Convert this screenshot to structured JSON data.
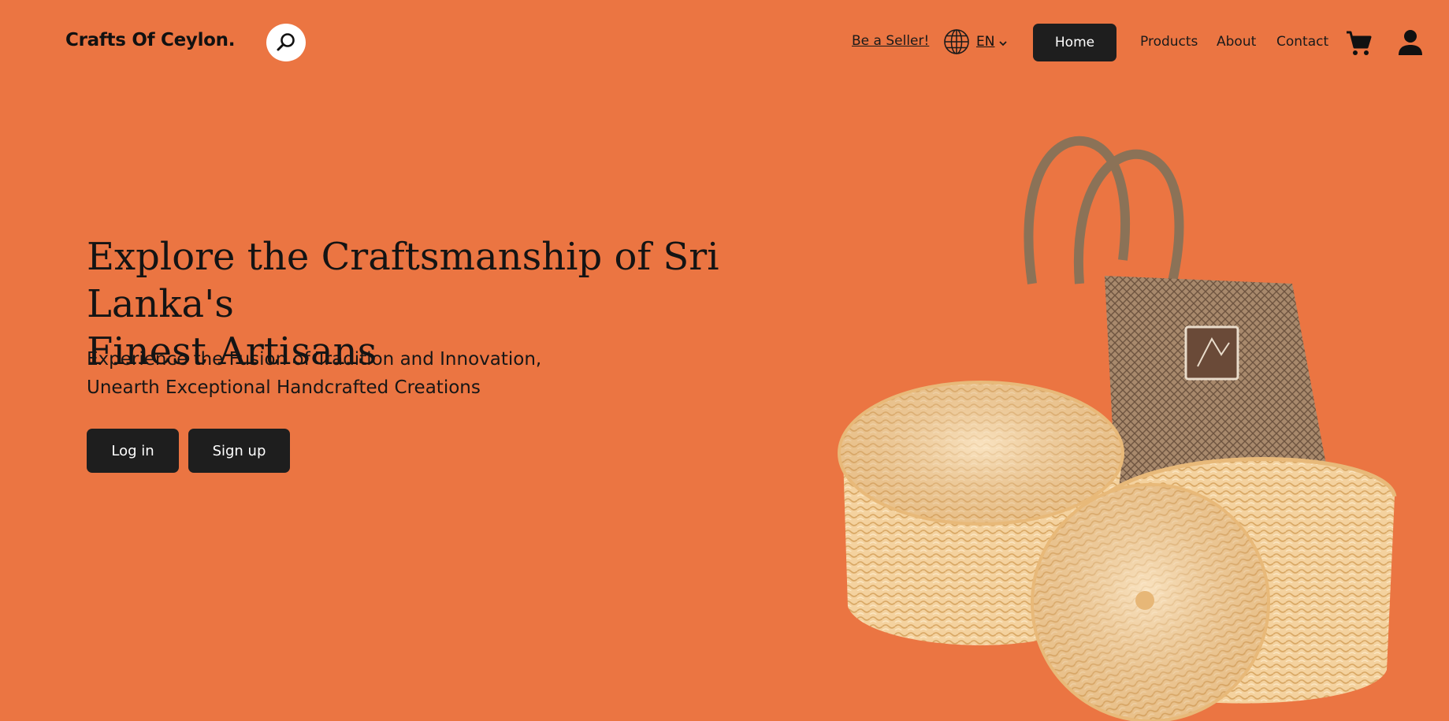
{
  "brand": {
    "logo_text": "Crafts Of Ceylon."
  },
  "nav": {
    "search_icon": "search-icon",
    "seller_link": "Be a Seller!",
    "language": {
      "icon": "globe-icon",
      "label": "EN"
    },
    "links": [
      "Home",
      "Products",
      "About",
      "Contact"
    ],
    "active_link": "Home",
    "cart_icon": "cart-icon",
    "user_icon": "user-icon"
  },
  "hero": {
    "title_line1": "Explore the Craftsmanship of Sri Lanka's",
    "title_line2": "Finest Artisans",
    "subtitle_line1": "Experience the Fusion of Tradition and Innovation,",
    "subtitle_line2": "Unearth Exceptional Handcrafted Creations",
    "login_label": "Log in",
    "signup_label": "Sign up",
    "image": "woven-baskets-and-bag"
  },
  "colors": {
    "background": "#EB7542",
    "button": "#1E1E1E",
    "button_text": "#FFFFFF",
    "text": "#141414"
  }
}
